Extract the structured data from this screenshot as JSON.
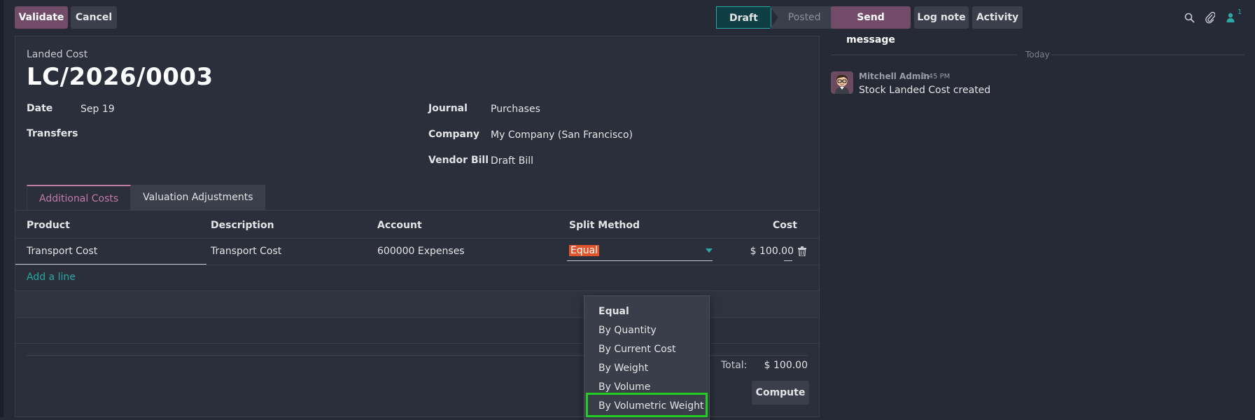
{
  "toolbar": {
    "validate_label": "Validate",
    "cancel_label": "Cancel"
  },
  "status": {
    "draft": "Draft",
    "posted": "Posted",
    "current": "Draft"
  },
  "form": {
    "header_label": "Landed Cost",
    "reference": "LC/2026/0003",
    "date_label": "Date",
    "date_value": "Sep 19",
    "transfers_label": "Transfers",
    "journal_label": "Journal",
    "journal_value": "Purchases",
    "company_label": "Company",
    "company_value": "My Company (San Francisco)",
    "vendor_bill_label": "Vendor Bill",
    "vendor_bill_value": "Draft Bill"
  },
  "tabs": [
    {
      "label": "Additional Costs",
      "active": true
    },
    {
      "label": "Valuation Adjustments",
      "active": false
    }
  ],
  "table": {
    "columns": [
      "Product",
      "Description",
      "Account",
      "Split Method",
      "Cost"
    ],
    "rows": [
      {
        "product": "Transport Cost",
        "description": "Transport Cost",
        "account": "600000 Expenses",
        "split_method": "Equal",
        "cost": "$ 100.00"
      }
    ],
    "add_line": "Add a line",
    "total_label": "Total:",
    "total_value": "$ 100.00",
    "compute_label": "Compute"
  },
  "split_dropdown": {
    "options": [
      "Equal",
      "By Quantity",
      "By Current Cost",
      "By Weight",
      "By Volume",
      "By Volumetric Weight"
    ],
    "selected": "Equal",
    "highlighted": "By Volumetric Weight"
  },
  "chatter": {
    "send_message": "Send message",
    "log_note": "Log note",
    "activity": "Activity",
    "follower_count": "1",
    "divider": "Today",
    "message_author": "Mitchell Admin",
    "message_time": "3:45 PM",
    "message_body": "Stock Landed Cost created"
  },
  "colors": {
    "primary": "#714b67",
    "accent": "#2ba8a3",
    "tab_active": "#c07ba6",
    "highlight": "#22cc22",
    "selected_text_bg": "#e0552b"
  },
  "icons": [
    "search-icon",
    "paperclip-icon",
    "follower-icon",
    "trash-icon",
    "caret-down-icon"
  ]
}
